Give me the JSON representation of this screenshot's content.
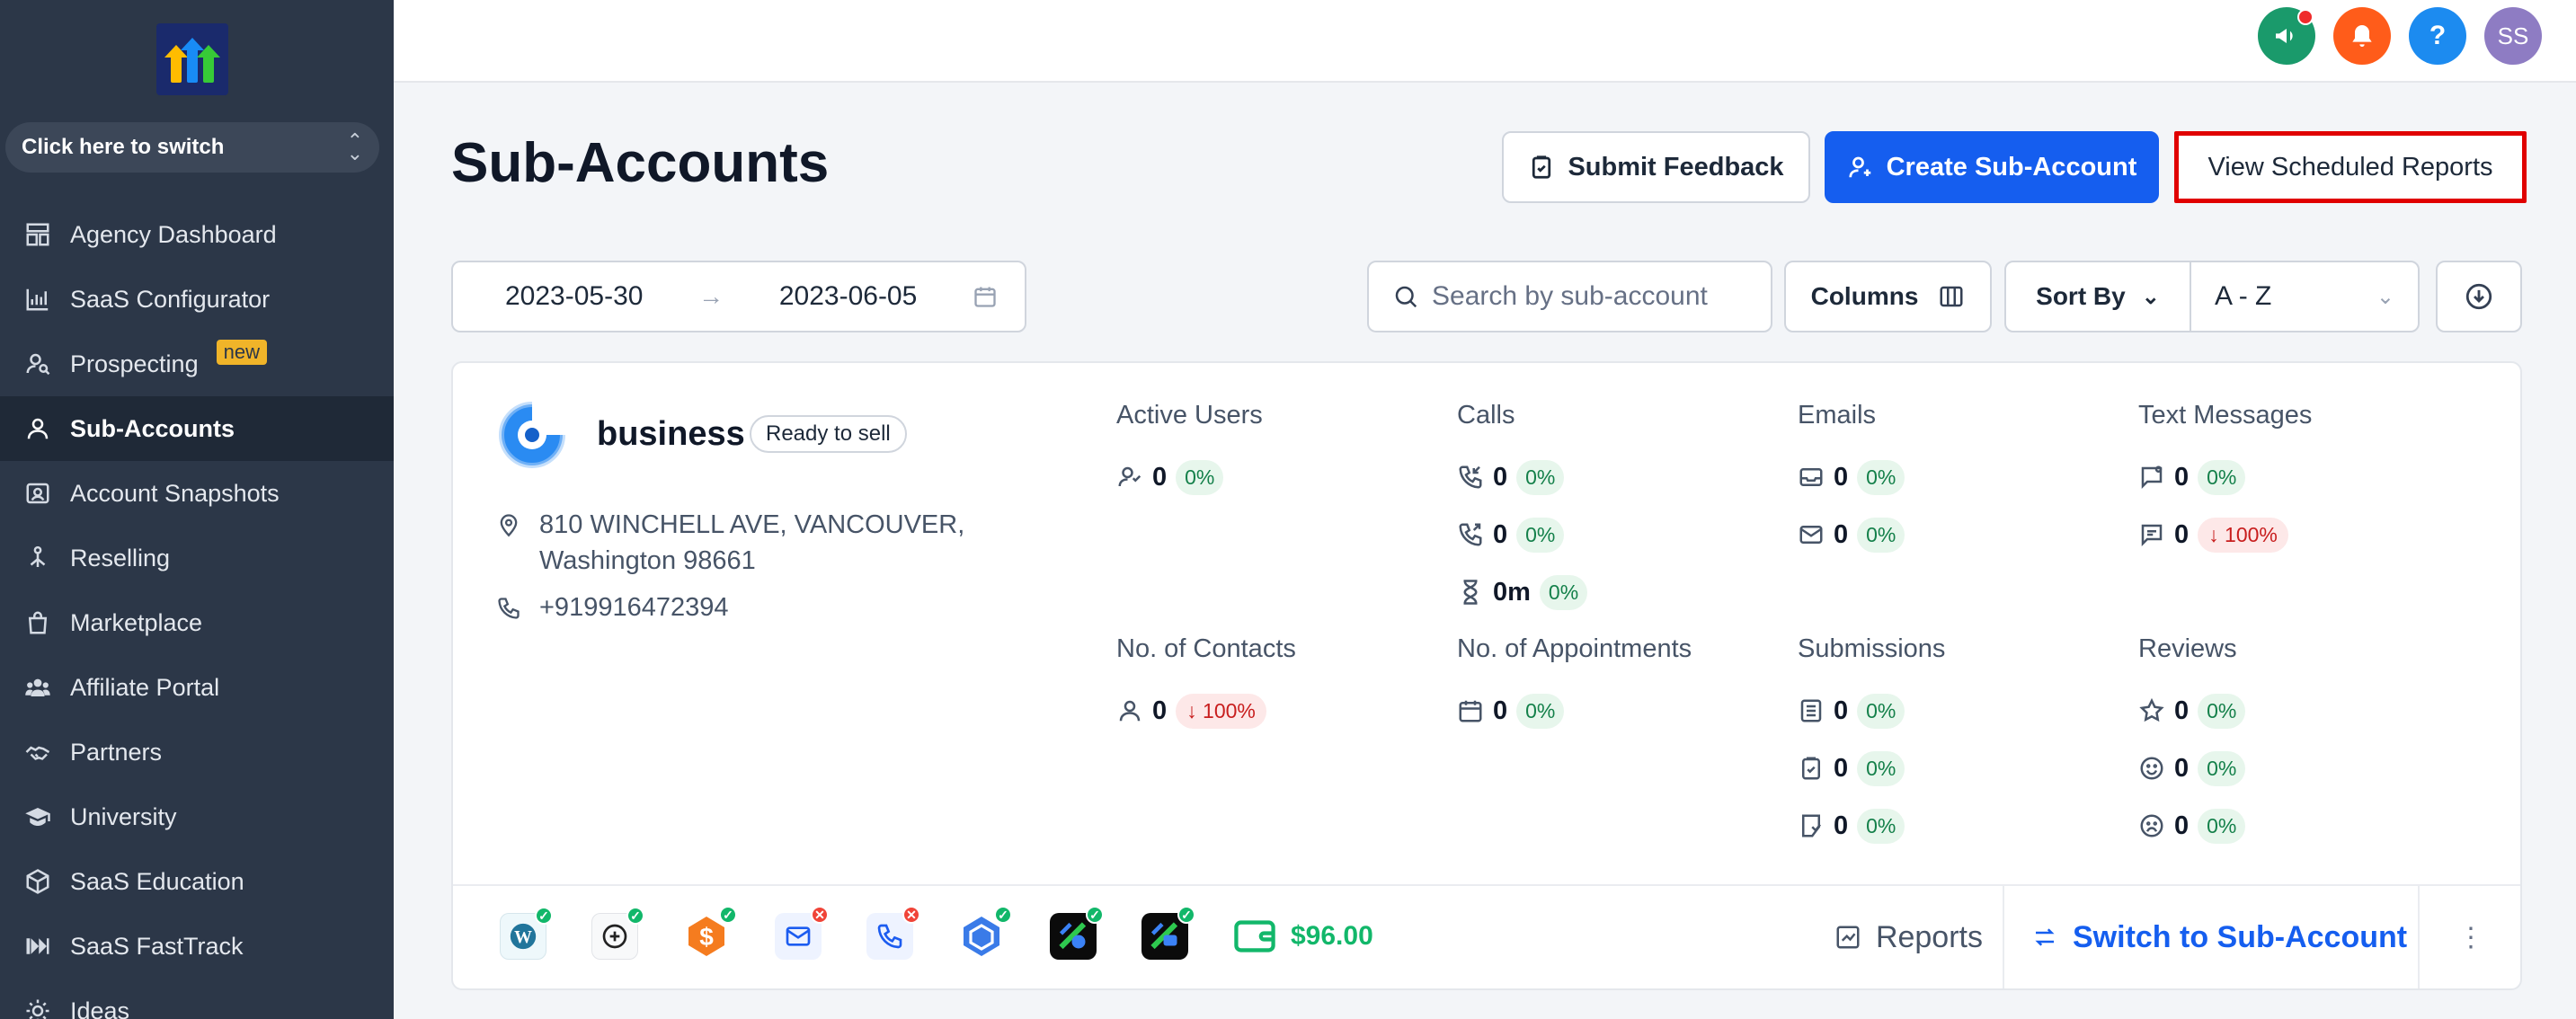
{
  "sidebar": {
    "switcher_label": "Click here to switch",
    "new_badge": "new",
    "items": [
      {
        "label": "Agency Dashboard",
        "icon": "dashboard-icon"
      },
      {
        "label": "SaaS Configurator",
        "icon": "bar-chart-icon"
      },
      {
        "label": "Prospecting",
        "icon": "prospecting-icon"
      },
      {
        "label": "Sub-Accounts",
        "icon": "user-icon"
      },
      {
        "label": "Account Snapshots",
        "icon": "snapshot-icon"
      },
      {
        "label": "Reselling",
        "icon": "reselling-icon"
      },
      {
        "label": "Marketplace",
        "icon": "bag-icon"
      },
      {
        "label": "Affiliate Portal",
        "icon": "people-icon"
      },
      {
        "label": "Partners",
        "icon": "handshake-icon"
      },
      {
        "label": "University",
        "icon": "graduation-cap-icon"
      },
      {
        "label": "SaaS Education",
        "icon": "box-icon"
      },
      {
        "label": "SaaS FastTrack",
        "icon": "fast-forward-icon"
      },
      {
        "label": "Ideas",
        "icon": "lightbulb-icon"
      }
    ]
  },
  "header": {
    "avatar_initials": "SS",
    "help_label": "?",
    "colors": {
      "announce": "#1a9a6b",
      "bell": "#ff5c1a",
      "help": "#1c8bf0",
      "avatar": "#8e7cc3"
    }
  },
  "page": {
    "title": "Sub-Accounts",
    "submit_feedback": "Submit Feedback",
    "create_sub_account": "Create Sub-Account",
    "view_scheduled_reports": "View Scheduled Reports"
  },
  "toolbar": {
    "date_start": "2023-05-30",
    "date_end": "2023-06-05",
    "search_placeholder": "Search by sub-account",
    "columns_label": "Columns",
    "sort_by_label": "Sort By",
    "sort_value": "A - Z"
  },
  "card": {
    "name": "business",
    "status": "Ready to sell",
    "address_line1": "810 WINCHELL AVE, VANCOUVER,",
    "address_line2": "Washington 98661",
    "phone": "+919916472394",
    "metrics": {
      "active_users": {
        "title": "Active Users",
        "rows": [
          {
            "value": "0",
            "pct": "0%"
          }
        ]
      },
      "calls": {
        "title": "Calls",
        "rows": [
          {
            "value": "0",
            "pct": "0%"
          },
          {
            "value": "0",
            "pct": "0%"
          },
          {
            "value": "0m",
            "pct": "0%"
          }
        ]
      },
      "emails": {
        "title": "Emails",
        "rows": [
          {
            "value": "0",
            "pct": "0%"
          },
          {
            "value": "0",
            "pct": "0%"
          }
        ]
      },
      "text_messages": {
        "title": "Text Messages",
        "rows": [
          {
            "value": "0",
            "pct": "0%"
          },
          {
            "value": "0",
            "pct": "100%"
          }
        ]
      },
      "contacts": {
        "title": "No. of Contacts",
        "rows": [
          {
            "value": "0",
            "pct": "100%"
          }
        ]
      },
      "appointments": {
        "title": "No. of Appointments",
        "rows": [
          {
            "value": "0",
            "pct": "0%"
          }
        ]
      },
      "submissions": {
        "title": "Submissions",
        "rows": [
          {
            "value": "0",
            "pct": "0%"
          },
          {
            "value": "0",
            "pct": "0%"
          },
          {
            "value": "0",
            "pct": "0%"
          }
        ]
      },
      "reviews": {
        "title": "Reviews",
        "rows": [
          {
            "value": "0",
            "pct": "0%"
          },
          {
            "value": "0",
            "pct": "0%"
          },
          {
            "value": "0",
            "pct": "0%"
          }
        ]
      }
    },
    "footer": {
      "wallet_balance": "$96.00",
      "reports_label": "Reports",
      "switch_label": "Switch to Sub-Account"
    }
  }
}
